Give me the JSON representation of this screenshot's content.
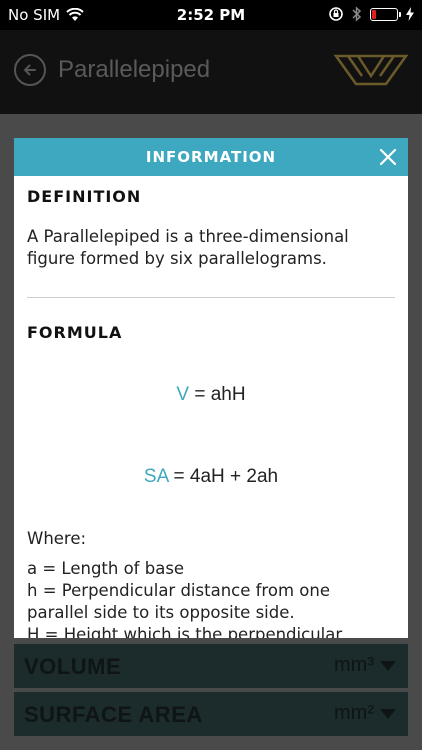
{
  "status": {
    "carrier": "No SIM",
    "time": "2:52 PM"
  },
  "nav": {
    "title": "Parallelepiped"
  },
  "modal": {
    "title": "INFORMATION",
    "definition_heading": "DEFINITION",
    "definition_text": "A Parallelepiped is a three-dimensional figure formed by six parallelograms.",
    "formula_heading": "FORMULA",
    "formulas": [
      {
        "var": "V",
        "expr": " = ahH"
      },
      {
        "var": "SA",
        "expr": " = 4aH + 2ah"
      }
    ],
    "where_label": "Where:",
    "where_items": [
      "a = Length of base",
      "h = Perpendicular distance from one parallel side to its opposite side.",
      "H = Height which is the perpendicular"
    ]
  },
  "rows": [
    {
      "label": "VOLUME",
      "unit": "mm³"
    },
    {
      "label": "SURFACE AREA",
      "unit": "mm²"
    }
  ],
  "colors": {
    "accent": "#3ea8c0",
    "backdrop": "#4a4a4a"
  }
}
